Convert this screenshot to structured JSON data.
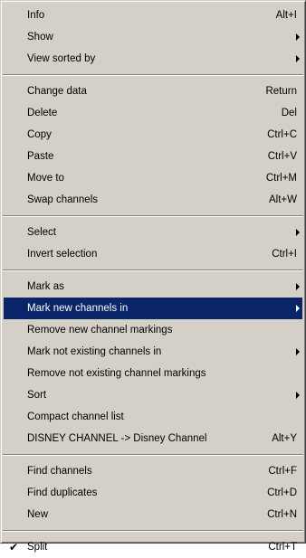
{
  "menu": {
    "groups": [
      [
        {
          "label": "Info",
          "shortcut": "Alt+I",
          "submenu": false
        },
        {
          "label": "Show",
          "shortcut": "",
          "submenu": true
        },
        {
          "label": "View sorted by",
          "shortcut": "",
          "submenu": true
        }
      ],
      [
        {
          "label": "Change data",
          "shortcut": "Return",
          "submenu": false
        },
        {
          "label": "Delete",
          "shortcut": "Del",
          "submenu": false
        },
        {
          "label": "Copy",
          "shortcut": "Ctrl+C",
          "submenu": false
        },
        {
          "label": "Paste",
          "shortcut": "Ctrl+V",
          "submenu": false
        },
        {
          "label": "Move to",
          "shortcut": "Ctrl+M",
          "submenu": false
        },
        {
          "label": "Swap channels",
          "shortcut": "Alt+W",
          "submenu": false
        }
      ],
      [
        {
          "label": "Select",
          "shortcut": "",
          "submenu": true
        },
        {
          "label": "Invert selection",
          "shortcut": "Ctrl+I",
          "submenu": false
        }
      ],
      [
        {
          "label": "Mark as",
          "shortcut": "",
          "submenu": true
        },
        {
          "label": "Mark new channels in",
          "shortcut": "",
          "submenu": true,
          "highlighted": true
        },
        {
          "label": "Remove new channel markings",
          "shortcut": "",
          "submenu": false
        },
        {
          "label": "Mark not existing channels in",
          "shortcut": "",
          "submenu": true
        },
        {
          "label": "Remove not existing channel markings",
          "shortcut": "",
          "submenu": false
        },
        {
          "label": "Sort",
          "shortcut": "",
          "submenu": true
        },
        {
          "label": "Compact channel list",
          "shortcut": "",
          "submenu": false
        },
        {
          "label": "DISNEY CHANNEL -> Disney Channel",
          "shortcut": "Alt+Y",
          "submenu": false
        }
      ],
      [
        {
          "label": "Find channels",
          "shortcut": "Ctrl+F",
          "submenu": false
        },
        {
          "label": "Find duplicates",
          "shortcut": "Ctrl+D",
          "submenu": false
        },
        {
          "label": "New",
          "shortcut": "Ctrl+N",
          "submenu": false
        }
      ],
      [
        {
          "label": "Split",
          "shortcut": "Ctrl+T",
          "submenu": false,
          "checked": true
        }
      ]
    ],
    "check_glyph": "✔",
    "colors": {
      "menu_background": "#d4d0c8",
      "highlight_background": "#0a246a",
      "highlight_text": "#ffffff"
    }
  }
}
